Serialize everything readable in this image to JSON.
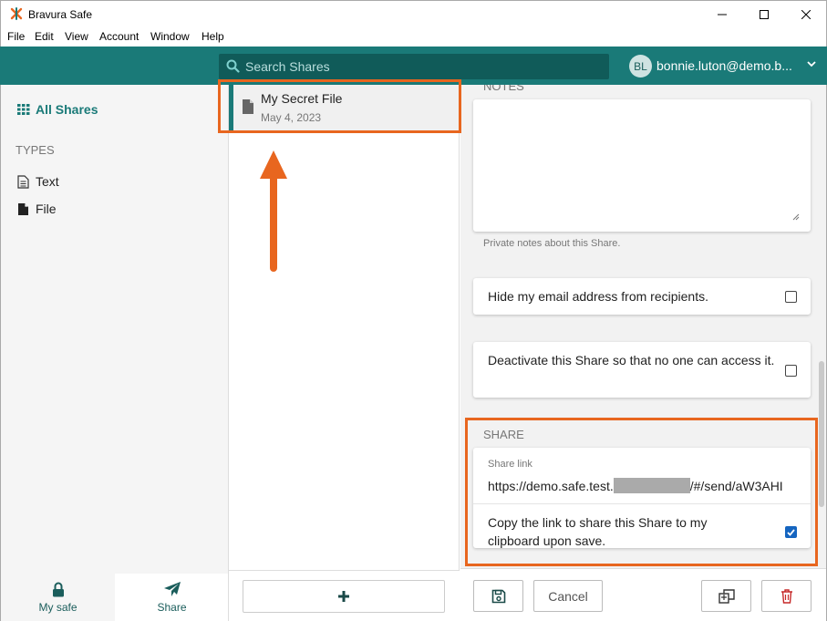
{
  "window": {
    "title": "Bravura Safe",
    "minimize_glyph": "—",
    "close_glyph": "✕"
  },
  "menu": [
    "File",
    "Edit",
    "View",
    "Account",
    "Window",
    "Help"
  ],
  "header": {
    "search_placeholder": "Search Shares",
    "avatar_initials": "BL",
    "user_email": "bonnie.luton@demo.b...",
    "colors": {
      "teal": "#1a7a78",
      "search_bg": "#105b59"
    }
  },
  "sidebar": {
    "all_shares_label": "All Shares",
    "types_heading": "TYPES",
    "types": [
      {
        "label": "Text",
        "icon": "text-document-icon"
      },
      {
        "label": "File",
        "icon": "file-icon"
      }
    ],
    "bottom_nav": [
      {
        "label": "My safe",
        "icon": "lock-icon"
      },
      {
        "label": "Share",
        "icon": "send-icon",
        "active": true
      }
    ]
  },
  "list": {
    "items": [
      {
        "name": "My Secret File",
        "date": "May 4, 2023",
        "icon": "file-icon",
        "selected": true
      }
    ],
    "add_icon": "plus-icon"
  },
  "detail": {
    "notes_label": "NOTES",
    "notes_value": "",
    "notes_help": "Private notes about this Share.",
    "hide_email_label": "Hide my email address from recipients.",
    "hide_email_checked": false,
    "deactivate_label": "Deactivate this Share so that no one can access it.",
    "deactivate_checked": false,
    "share_section_label": "SHARE",
    "share_link_label": "Share link",
    "share_link_prefix": "https://demo.safe.test.",
    "share_link_suffix": "/#/send/aW3AHI",
    "copy_link_label": "Copy the link to share this Share to my clipboard upon save.",
    "copy_link_checked": true,
    "buttons": {
      "save_icon": "save-icon",
      "cancel_label": "Cancel",
      "clone_icon": "clone-icon",
      "delete_icon": "trash-icon"
    }
  },
  "annotation": {
    "highlight_color": "#e8661f"
  }
}
